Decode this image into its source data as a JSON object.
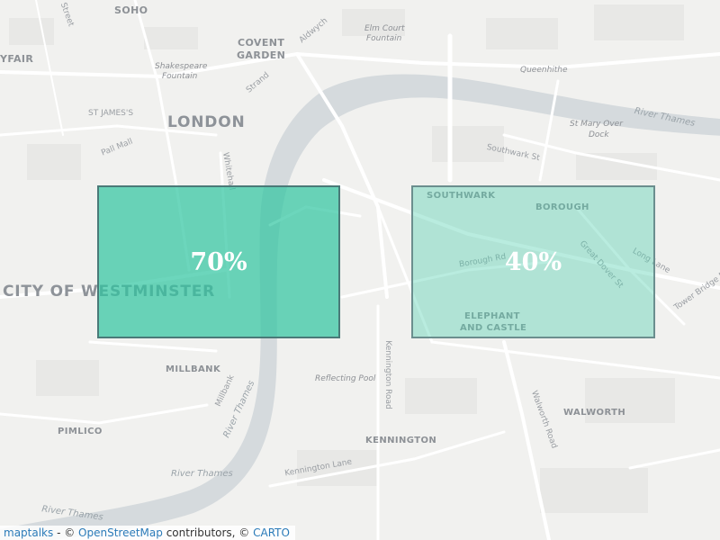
{
  "map": {
    "labels": {
      "soho": "SOHO",
      "fair": "YFAIR",
      "covent": "COVENT",
      "garden": "GARDEN",
      "elm": "Elm Court",
      "fountain": "Fountain",
      "shakespeare": "Shakespeare",
      "fountain2": "Fountain",
      "queenhithe": "Queenhithe",
      "stjames": "ST JAMES'S",
      "london": "LONDON",
      "stmary": "St Mary Over",
      "dock": "Dock",
      "riverthames_top": "River Thames",
      "pallmall": "Pall Mall",
      "southwark_st": "Southwark St",
      "southwark": "SOUTHWARK",
      "borough": "BOROUGH",
      "westminster": "CITY OF WESTMINSTER",
      "elephant1": "ELEPHANT",
      "elephant2": "AND CASTLE",
      "millbank": "MILLBANK",
      "reflecting": "Reflecting Pool",
      "kennington_rd": "Kennington Road",
      "walworth_rd": "Walworth Road",
      "walworth": "WALWORTH",
      "pimlico": "PIMLICO",
      "kennington": "KENNINGTON",
      "riverthames_mid": "River Thames",
      "riverthames_low": "River Thames",
      "riverthames_bottom": "River Thames",
      "kennington_ln": "Kennington Lane",
      "strand": "Strand",
      "aldwych": "Aldwych",
      "millbank_rd": "Millbank",
      "great_dover": "Great Dover St",
      "tower_bridge": "Tower Bridge Rd",
      "long_lane": "Long Lane",
      "borough_rd": "Borough Rd",
      "whitehall": "Whitehall",
      "ststreet": "Street"
    }
  },
  "overlays": [
    {
      "name": "rect-westminster",
      "label": "70%",
      "fill": "#2ec4a0",
      "opacity": 0.7,
      "stroke": "#4a7a78"
    },
    {
      "name": "rect-southwark",
      "label": "40%",
      "fill": "#4fcfb0",
      "opacity": 0.4,
      "stroke": "#6b8e8e"
    }
  ],
  "attribution": {
    "maptalks": "maptalks",
    "sep1": " - © ",
    "osm": "OpenStreetMap",
    "contributors": " contributors, © ",
    "carto": "CARTO"
  },
  "colors": {
    "background": "#f3f3f1",
    "water": "#d5dadd",
    "road": "#ffffff",
    "block": "#e9e9e7",
    "link": "#2b7bb9"
  }
}
